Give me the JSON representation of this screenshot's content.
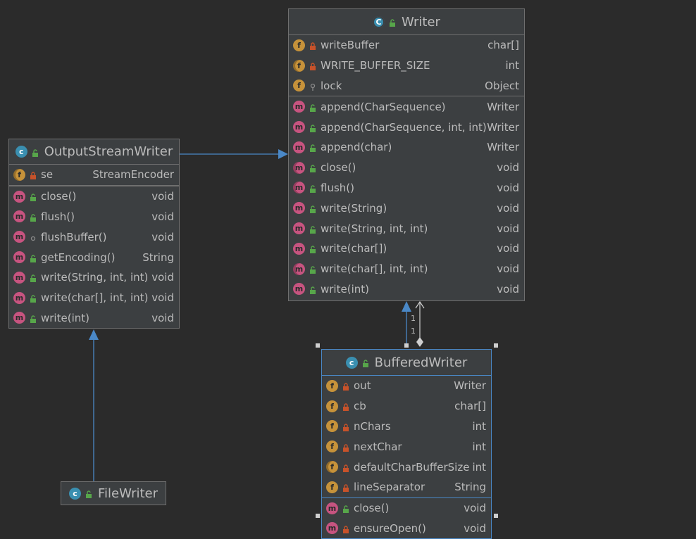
{
  "colors": {
    "background": "#2b2b2b",
    "box": "#3c3f41",
    "border": "#6f6f6f",
    "selected_border": "#4a88c7",
    "arrow": "#4a88c7",
    "field_icon": "#c6923a",
    "method_icon": "#c75480",
    "class_icon": "#3a8fb0",
    "public": "#57a64a",
    "private": "#c7522a"
  },
  "writer": {
    "title": "Writer",
    "kind_icon": "abstract-class-icon",
    "fields": [
      {
        "name": "writeBuffer",
        "type": "char[]",
        "visibility": "private"
      },
      {
        "name": "WRITE_BUFFER_SIZE",
        "type": "int",
        "visibility": "private",
        "static": true
      },
      {
        "name": "lock",
        "type": "Object",
        "visibility": "protected"
      }
    ],
    "methods": [
      {
        "name": "append(CharSequence)",
        "type": "Writer",
        "visibility": "public"
      },
      {
        "name": "append(CharSequence, int, int)",
        "type": "Writer",
        "visibility": "public"
      },
      {
        "name": "append(char)",
        "type": "Writer",
        "visibility": "public"
      },
      {
        "name": "close()",
        "type": "void",
        "visibility": "public",
        "abstract": true
      },
      {
        "name": "flush()",
        "type": "void",
        "visibility": "public",
        "abstract": true
      },
      {
        "name": "write(String)",
        "type": "void",
        "visibility": "public"
      },
      {
        "name": "write(String, int, int)",
        "type": "void",
        "visibility": "public"
      },
      {
        "name": "write(char[])",
        "type": "void",
        "visibility": "public"
      },
      {
        "name": "write(char[], int, int)",
        "type": "void",
        "visibility": "public",
        "abstract": true
      },
      {
        "name": "write(int)",
        "type": "void",
        "visibility": "public"
      }
    ]
  },
  "outputstreamwriter": {
    "title": "OutputStreamWriter",
    "kind_icon": "class-icon",
    "fields": [
      {
        "name": "se",
        "type": "StreamEncoder",
        "visibility": "private",
        "static": true
      }
    ],
    "methods": [
      {
        "name": "close()",
        "type": "void",
        "visibility": "public"
      },
      {
        "name": "flush()",
        "type": "void",
        "visibility": "public"
      },
      {
        "name": "flushBuffer()",
        "type": "void",
        "visibility": "package"
      },
      {
        "name": "getEncoding()",
        "type": "String",
        "visibility": "public"
      },
      {
        "name": "write(String, int, int)",
        "type": "void",
        "visibility": "public"
      },
      {
        "name": "write(char[], int, int)",
        "type": "void",
        "visibility": "public"
      },
      {
        "name": "write(int)",
        "type": "void",
        "visibility": "public"
      }
    ]
  },
  "filewriter": {
    "title": "FileWriter",
    "kind_icon": "class-icon"
  },
  "bufferedwriter": {
    "title": "BufferedWriter",
    "kind_icon": "class-icon",
    "fields": [
      {
        "name": "out",
        "type": "Writer",
        "visibility": "private"
      },
      {
        "name": "cb",
        "type": "char[]",
        "visibility": "private"
      },
      {
        "name": "nChars",
        "type": "int",
        "visibility": "private"
      },
      {
        "name": "nextChar",
        "type": "int",
        "visibility": "private"
      },
      {
        "name": "defaultCharBufferSize",
        "type": "int",
        "visibility": "private",
        "static": true
      },
      {
        "name": "lineSeparator",
        "type": "String",
        "visibility": "private"
      }
    ],
    "methods": [
      {
        "name": "close()",
        "type": "void",
        "visibility": "public"
      },
      {
        "name": "ensureOpen()",
        "type": "void",
        "visibility": "private"
      }
    ]
  },
  "relations": {
    "multiplicity_top": "1",
    "multiplicity_bottom": "1"
  }
}
